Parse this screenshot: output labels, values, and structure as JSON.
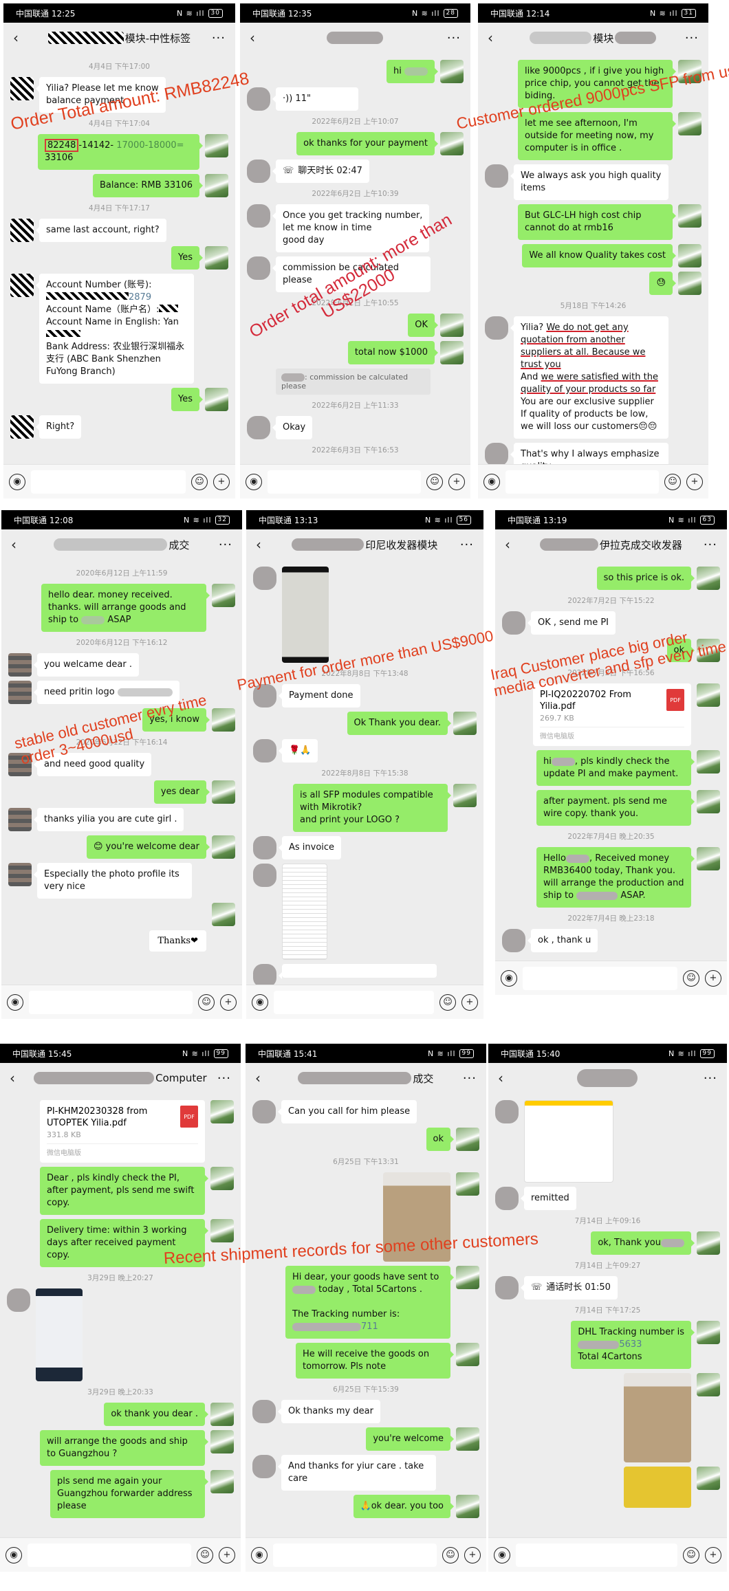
{
  "panels": [
    {
      "status": {
        "carrier": "中国联通",
        "time": "12:25",
        "battery": "30"
      },
      "title": {
        "suffix": "模块-中性标签"
      },
      "messages": {
        "ts1": "4月4日 下午17:00",
        "m1": "Yilia? Please let me know\nbalance payment",
        "ts2": "4月4日 下午17:04",
        "m2_highlight": "82248",
        "m2_rest": "-14142- ",
        "m2_green": "17000-18000=",
        "m2_end": "33106",
        "m3": "Balance:  RMB 33106",
        "ts3": "4月4日 下午17:17",
        "m4": "same last account, right?",
        "m5": "Yes",
        "m6_l1": "Account Number (账号):",
        "m6_l2": "2879",
        "m6_l3": "Account Name（账户名）:",
        "m6_l4": "Account Name in English: Yan",
        "m6_l5": "Bank Address: 农业银行深圳福永支行 (ABC Bank Shenzhen FuYong Branch)",
        "m7": "Yes",
        "m8": "Right?"
      },
      "annotation": "Order Total amount: RMB82248"
    },
    {
      "status": {
        "carrier": "中国联通",
        "time": "12:35",
        "battery": "28"
      },
      "messages": {
        "m1": "hi",
        "voice": "11\"",
        "ts1": "2022年6月2日 上午10:07",
        "m2": "ok thanks for your payment",
        "call": "聊天时长 02:47",
        "ts2": "2022年6月2日 上午10:39",
        "m3": "Once you get tracking number,\nlet me know in time\ngood day",
        "m4": "commission be calculated please",
        "ts3": "2022年6月2日 上午10:55",
        "m5": "OK",
        "m6": "total now $1000",
        "quote": "commission be calculated please",
        "ts4": "2022年6月2日 上午11:33",
        "m7": "Okay",
        "ts5": "2022年6月3日 下午16:53"
      },
      "annotation_l1": "Order total amount: more than",
      "annotation_l2": "US$22000"
    },
    {
      "status": {
        "carrier": "中国联通",
        "time": "12:14",
        "battery": "31"
      },
      "title": {
        "suffix": "模块"
      },
      "messages": {
        "m1": "like 9000pcs , if i give you high price chip, you cannot get the biding.",
        "m2": "let me see afternoon, I'm outside for meeting now, my computer is in office .",
        "m3": "We always ask you high quality items",
        "m4": "But GLC-LH high cost chip cannot do at rmb16",
        "m5": "We all know Quality takes cost",
        "m6": "😓",
        "ts1": "5月18日 下午14:26",
        "m7_a": "Yilia? ",
        "m7_b": "We do not get any quotation from another suppliers at all. Because we trust you",
        "m7_c": "And ",
        "m7_d": "we were satisfied with the quality of your products so far",
        "m7_e": "You are our exclusive supplier\nIf quality of products be low, we will loss our customers😔😔",
        "m8": "That's why I always emphasize quality"
      },
      "annotation": "Customer ordered 9000pcs SFP from us"
    },
    {
      "status": {
        "carrier": "中国联通",
        "time": "12:08",
        "battery": "32"
      },
      "title": {
        "suffix": "成交"
      },
      "messages": {
        "ts1": "2020年6月12日 上午11:59",
        "m1_a": "hello dear.  money received.\nthanks.  will arrange goods and ship to",
        "m1_b": "ASAP",
        "ts2": "2020年6月12日 下午16:12",
        "m2": "you welcame dear .",
        "m3": "need pritin logo",
        "m4": "yes, i know",
        "ts3": "2020年6月12日 下午16:14",
        "m5": "and need good quality",
        "m6": "yes dear",
        "m7": "thanks yilia you are cute girl .",
        "m8": "😊 you're welcome dear",
        "m9": "Especially the photo profile its very nice",
        "sticker": "Thanks❤"
      },
      "annotation_l1": "stable old customer evry time",
      "annotation_l2": "order 3~4000usd"
    },
    {
      "status": {
        "carrier": "中国联通",
        "time": "13:13",
        "battery": "56"
      },
      "title": {
        "suffix": "印尼收发器模块"
      },
      "messages": {
        "ts1": "2022年8月8日 下午13:48",
        "m1": "Payment done",
        "m2": "Ok Thank you dear.",
        "m3": "🌹🙏",
        "ts2": "2022年8月8日 下午15:38",
        "m4": "is all SFP modules compatible with Mikrotik?\nand print your LOGO ?",
        "m5": "As invoice"
      },
      "annotation": "Payment for order more than US$9000"
    },
    {
      "status": {
        "carrier": "中国联通",
        "time": "13:19",
        "battery": "63"
      },
      "title": {
        "suffix": "伊拉克成交收发器"
      },
      "messages": {
        "m1": "so this price is ok.",
        "ts1": "2022年7月2日 下午15:22",
        "m2": "OK , send me PI",
        "m3": "ok",
        "ts2": "2022年7月2日 下午16:56",
        "file_name": "PI-IQ20220702 From Yilia.pdf",
        "file_size": "269.7 KB",
        "file_src": "微信电脑版",
        "pdf_label": "PDF",
        "m4_a": "hi",
        "m4_b": ",   pls kindly check the update PI and make payment.",
        "m5": "after payment. pls send me wire copy. thank you.",
        "ts3": "2022年7月4日 晚上20:35",
        "m6_a": "Hello",
        "m6_b": ", Received money RMB36400 today, Thank you. will arrange the production and ship to",
        "m6_c": "ASAP.",
        "ts4": "2022年7月4日 晚上23:18",
        "m7": "ok , thank u"
      },
      "annotation_l1": "Iraq Customer place big order",
      "annotation_l2": "media converter and sfp every time"
    },
    {
      "status": {
        "carrier": "中国联通",
        "time": "15:45",
        "battery": "99"
      },
      "title": {
        "suffix": "Computer"
      },
      "messages": {
        "file_name": "PI-KHM20230328 from UTOPTEK Yilia.pdf",
        "file_size": "331.8 KB",
        "file_src": "微信电脑版",
        "pdf_label": "PDF",
        "m1": "Dear , pls kindly check the PI, after payment, pls send me swift copy.",
        "m2": "Delivery time: within 3 working days after received payment copy.",
        "ts1": "3月29日 晚上20:27",
        "ts2": "3月29日 晚上20:33",
        "m3": "ok thank you dear .",
        "m4": "will arrange the goods and ship to Guangzhou ?",
        "m5": "pls send me again your Guangzhou forwarder address please"
      }
    },
    {
      "status": {
        "carrier": "中国联通",
        "time": "15:41",
        "battery": "99"
      },
      "title": {
        "suffix": "成交"
      },
      "messages": {
        "m1": "Can you call for him please",
        "m2": "ok",
        "ts1": "6月25日 下午13:31",
        "m3_a": "Hi dear, your goods have sent to",
        "m3_b": "today , Total 5Cartons .",
        "m3_c": "The Tracking number is:",
        "m3_d": "711",
        "m4": "He will receive the goods on tomorrow. Pls note",
        "ts2": "6月25日 下午15:39",
        "m5": "Ok thanks my dear",
        "m6": "you're welcome",
        "m7": "And thanks for yiur care . take care",
        "m8": "🙏ok dear. you too"
      },
      "annotation": "Recent shipment records for some other customers"
    },
    {
      "status": {
        "carrier": "中国联通",
        "time": "15:40",
        "battery": "99"
      },
      "messages": {
        "m1": "remitted",
        "ts1": "7月14日 上午09:16",
        "m2": "ok, Thank you",
        "ts2": "7月14日 上午09:27",
        "call": "通话时长 01:50",
        "ts3": "7月14日 下午17:25",
        "m3_a": "DHL Tracking number is",
        "m3_b": "5633",
        "m3_c": "Total 4Cartons"
      }
    }
  ],
  "icons": {
    "back": "‹",
    "more": "···",
    "voice": "◉",
    "emoji": "☺",
    "plus": "+",
    "call": "☏"
  }
}
